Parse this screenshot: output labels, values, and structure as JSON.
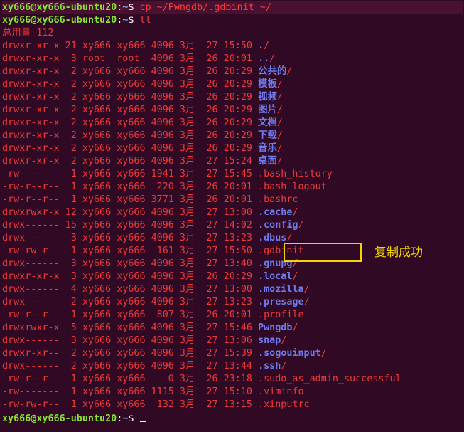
{
  "prompt": {
    "user_host": "xy666@xy666-ubuntu20",
    "sep": ":",
    "path": "~",
    "sym": "$ "
  },
  "commands": [
    "cp ~/Pwngdb/.gdbinit ~/",
    "ll"
  ],
  "total_line": "总用量 112",
  "entries": [
    {
      "meta": "drwxr-xr-x 21 xy666 xy666 4096 3月  27 15:50 ",
      "name": ".",
      "type": "dir"
    },
    {
      "meta": "drwxr-xr-x  3 root  root  4096 3月  26 20:01 ",
      "name": "..",
      "type": "dir"
    },
    {
      "meta": "drwxr-xr-x  2 xy666 xy666 4096 3月  26 20:29 ",
      "name": "公共的",
      "type": "dir"
    },
    {
      "meta": "drwxr-xr-x  2 xy666 xy666 4096 3月  26 20:29 ",
      "name": "模板",
      "type": "dir"
    },
    {
      "meta": "drwxr-xr-x  2 xy666 xy666 4096 3月  26 20:29 ",
      "name": "视频",
      "type": "dir"
    },
    {
      "meta": "drwxr-xr-x  2 xy666 xy666 4096 3月  26 20:29 ",
      "name": "图片",
      "type": "dir"
    },
    {
      "meta": "drwxr-xr-x  2 xy666 xy666 4096 3月  26 20:29 ",
      "name": "文档",
      "type": "dir"
    },
    {
      "meta": "drwxr-xr-x  2 xy666 xy666 4096 3月  26 20:29 ",
      "name": "下载",
      "type": "dir"
    },
    {
      "meta": "drwxr-xr-x  2 xy666 xy666 4096 3月  26 20:29 ",
      "name": "音乐",
      "type": "dir"
    },
    {
      "meta": "drwxr-xr-x  2 xy666 xy666 4096 3月  27 15:24 ",
      "name": "桌面",
      "type": "dir"
    },
    {
      "meta": "-rw-------  1 xy666 xy666 1941 3月  27 15:45 ",
      "name": ".bash_history",
      "type": "file"
    },
    {
      "meta": "-rw-r--r--  1 xy666 xy666  220 3月  26 20:01 ",
      "name": ".bash_logout",
      "type": "file"
    },
    {
      "meta": "-rw-r--r--  1 xy666 xy666 3771 3月  26 20:01 ",
      "name": ".bashrc",
      "type": "file"
    },
    {
      "meta": "drwxrwxr-x 12 xy666 xy666 4096 3月  27 13:00 ",
      "name": ".cache",
      "type": "dir"
    },
    {
      "meta": "drwx------ 15 xy666 xy666 4096 3月  27 14:02 ",
      "name": ".config",
      "type": "dir"
    },
    {
      "meta": "drwx------  3 xy666 xy666 4096 3月  27 13:23 ",
      "name": ".dbus",
      "type": "dir"
    },
    {
      "meta": "-rw-rw-r--  1 xy666 xy666  161 3月  27 15:50 ",
      "name": ".gdbinit",
      "type": "file"
    },
    {
      "meta": "drwx------  3 xy666 xy666 4096 3月  27 13:40 ",
      "name": ".gnupg",
      "type": "dir"
    },
    {
      "meta": "drwxr-xr-x  3 xy666 xy666 4096 3月  26 20:29 ",
      "name": ".local",
      "type": "dir"
    },
    {
      "meta": "drwx------  4 xy666 xy666 4096 3月  27 13:00 ",
      "name": ".mozilla",
      "type": "dir"
    },
    {
      "meta": "drwx------  2 xy666 xy666 4096 3月  27 13:23 ",
      "name": ".presage",
      "type": "dir"
    },
    {
      "meta": "-rw-r--r--  1 xy666 xy666  807 3月  26 20:01 ",
      "name": ".profile",
      "type": "file"
    },
    {
      "meta": "drwxrwxr-x  5 xy666 xy666 4096 3月  27 15:46 ",
      "name": "Pwngdb",
      "type": "dir"
    },
    {
      "meta": "drwx------  3 xy666 xy666 4096 3月  27 13:06 ",
      "name": "snap",
      "type": "dir"
    },
    {
      "meta": "drwxr-xr--  2 xy666 xy666 4096 3月  27 15:39 ",
      "name": ".sogouinput",
      "type": "dir"
    },
    {
      "meta": "drwx------  2 xy666 xy666 4096 3月  27 13:44 ",
      "name": ".ssh",
      "type": "dir"
    },
    {
      "meta": "-rw-r--r--  1 xy666 xy666    0 3月  26 23:18 ",
      "name": ".sudo_as_admin_successful",
      "type": "file"
    },
    {
      "meta": "-rw-------  1 xy666 xy666 1115 3月  27 15:10 ",
      "name": ".viminfo",
      "type": "file"
    },
    {
      "meta": "-rw-rw-r--  1 xy666 xy666  132 3月  27 13:15 ",
      "name": ".xinputrc",
      "type": "file"
    }
  ],
  "annotation": "复制成功",
  "colors": {
    "background": "#300a24",
    "prompt_user": "#8ae234",
    "prompt_path": "#729fcf",
    "listing": "#ef3a3a",
    "directory": "#6f7cf0",
    "annotation": "#f3d300"
  }
}
